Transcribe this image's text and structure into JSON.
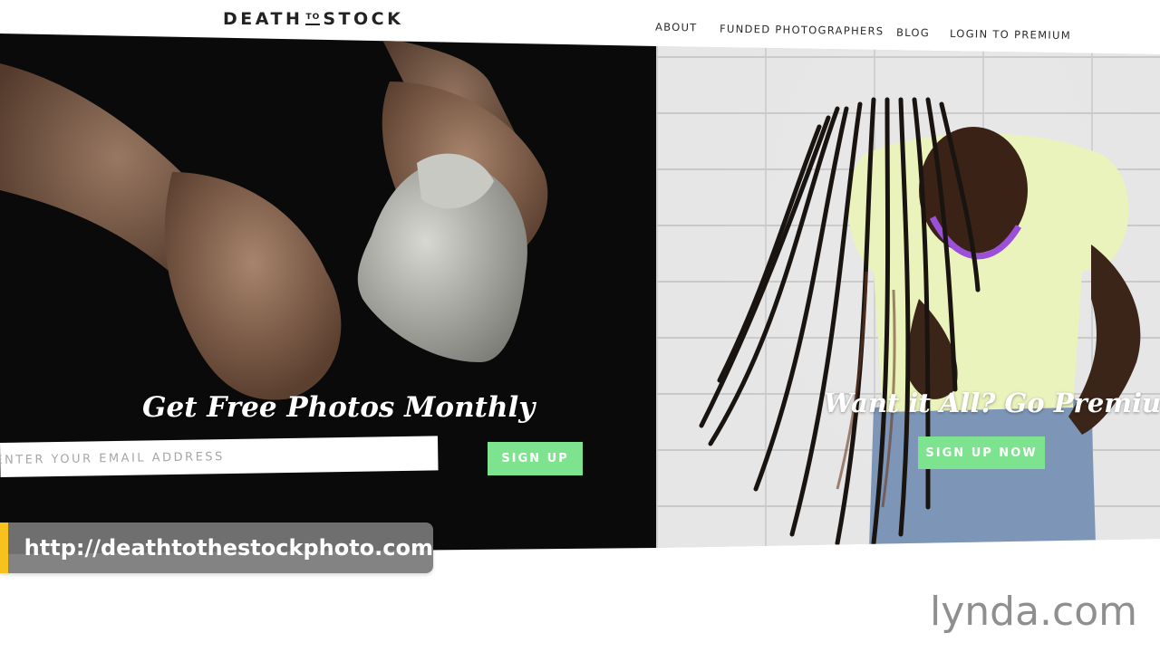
{
  "site": {
    "logo": {
      "part1": "DEATH",
      "part2": "TO",
      "part3": "STOCK"
    },
    "nav": [
      {
        "label": "ABOUT"
      },
      {
        "label": "FUNDED PHOTOGRAPHERS"
      },
      {
        "label": "BLOG"
      },
      {
        "label": "LOGIN TO PREMIUM"
      }
    ]
  },
  "left_panel": {
    "headline": "Get Free Photos Monthly",
    "email_placeholder": "ENTER YOUR EMAIL ADDRESS",
    "signup_label": "SIGN UP"
  },
  "right_panel": {
    "headline": "Want it All? Go Premium",
    "signup_label": "SIGN UP NOW"
  },
  "overlay": {
    "url": "http://deathtothestockphoto.com",
    "accent_color": "#f7c21e"
  },
  "watermark": {
    "name": "lynda",
    "suffix": ".com"
  },
  "colors": {
    "button_green": "#7ee38f",
    "hero_dark": "#0a0a0a"
  }
}
